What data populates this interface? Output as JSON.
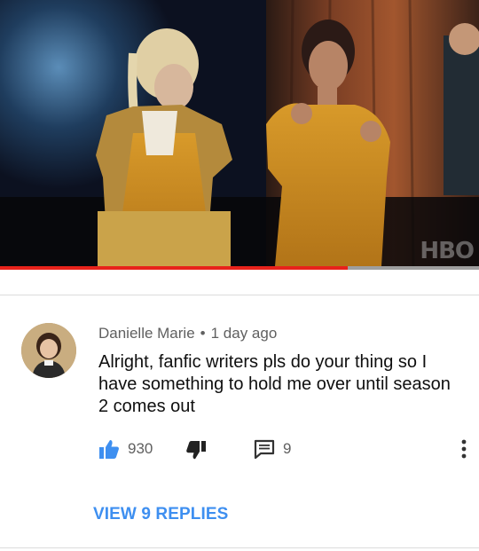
{
  "video": {
    "watermark": "HBO",
    "progress_percent": 72.6
  },
  "comment": {
    "author": "Danielle Marie",
    "separator": "•",
    "time": "1 day ago",
    "text": "Alright, fanfic writers pls do your thing so I have something to hold me over until season 2 comes out",
    "likes": "930",
    "replies": "9"
  },
  "actions": {
    "like_icon": "thumbs-up-icon",
    "dislike_icon": "thumbs-down-icon",
    "reply_icon": "comment-icon",
    "more_icon": "more-vertical-icon"
  },
  "view_replies": "VIEW 9 REPLIES",
  "colors": {
    "accent_blue": "#3e8ff0",
    "progress_red": "#e8221b",
    "meta_gray": "#606060"
  }
}
